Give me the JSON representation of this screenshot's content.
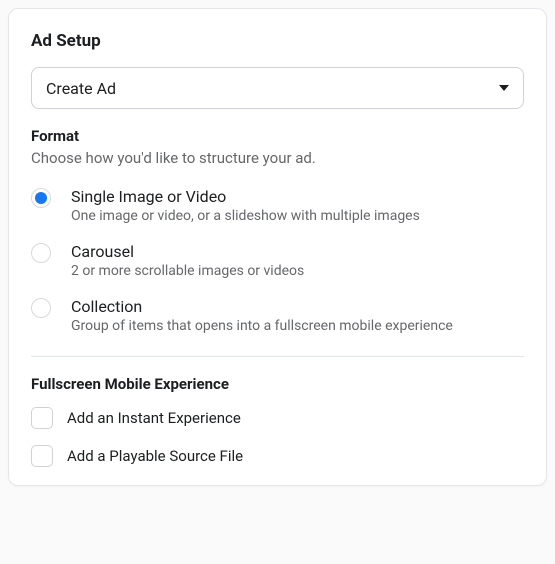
{
  "title": "Ad Setup",
  "select": {
    "value": "Create Ad"
  },
  "format": {
    "label": "Format",
    "help": "Choose how you'd like to structure your ad.",
    "options": [
      {
        "title": "Single Image or Video",
        "desc": "One image or video, or a slideshow with multiple images",
        "selected": true
      },
      {
        "title": "Carousel",
        "desc": "2 or more scrollable images or videos",
        "selected": false
      },
      {
        "title": "Collection",
        "desc": "Group of items that opens into a fullscreen mobile experience",
        "selected": false
      }
    ]
  },
  "fullscreen": {
    "label": "Fullscreen Mobile Experience",
    "checks": [
      {
        "label": "Add an Instant Experience",
        "checked": false
      },
      {
        "label": "Add a Playable Source File",
        "checked": false
      }
    ]
  }
}
